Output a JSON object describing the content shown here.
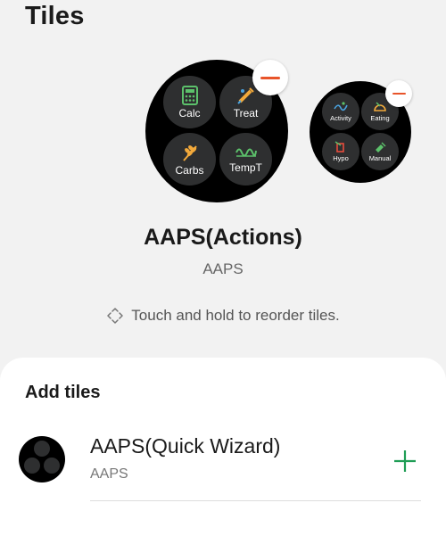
{
  "page": {
    "title": "Tiles"
  },
  "current_tile": {
    "name": "AAPS(Actions)",
    "app": "AAPS",
    "large_preview": [
      {
        "label": "Calc",
        "icon": "calculator-icon",
        "color": "#5cc16b"
      },
      {
        "label": "Treat",
        "icon": "syringe-icon",
        "color": "#f2a93b"
      },
      {
        "label": "Carbs",
        "icon": "wheat-icon",
        "color": "#f2a93b"
      },
      {
        "label": "TempT",
        "icon": "temp-target-icon",
        "color": "#5cc16b"
      }
    ]
  },
  "small_preview": [
    {
      "label": "Activity",
      "icon": "activity-icon",
      "color": "#4aa3df"
    },
    {
      "label": "Eating",
      "icon": "eating-icon",
      "color": "#f2a93b"
    },
    {
      "label": "Hypo",
      "icon": "hypo-icon",
      "color": "#e74c3c"
    },
    {
      "label": "Manual",
      "icon": "manual-icon",
      "color": "#5cc16b"
    }
  ],
  "hint": "Touch and hold to reorder tiles.",
  "add_tiles": {
    "title": "Add tiles",
    "items": [
      {
        "name": "AAPS(Quick Wizard)",
        "app": "AAPS"
      }
    ]
  },
  "colors": {
    "accent_remove": "#e8542a",
    "accent_add": "#1f9d55"
  }
}
